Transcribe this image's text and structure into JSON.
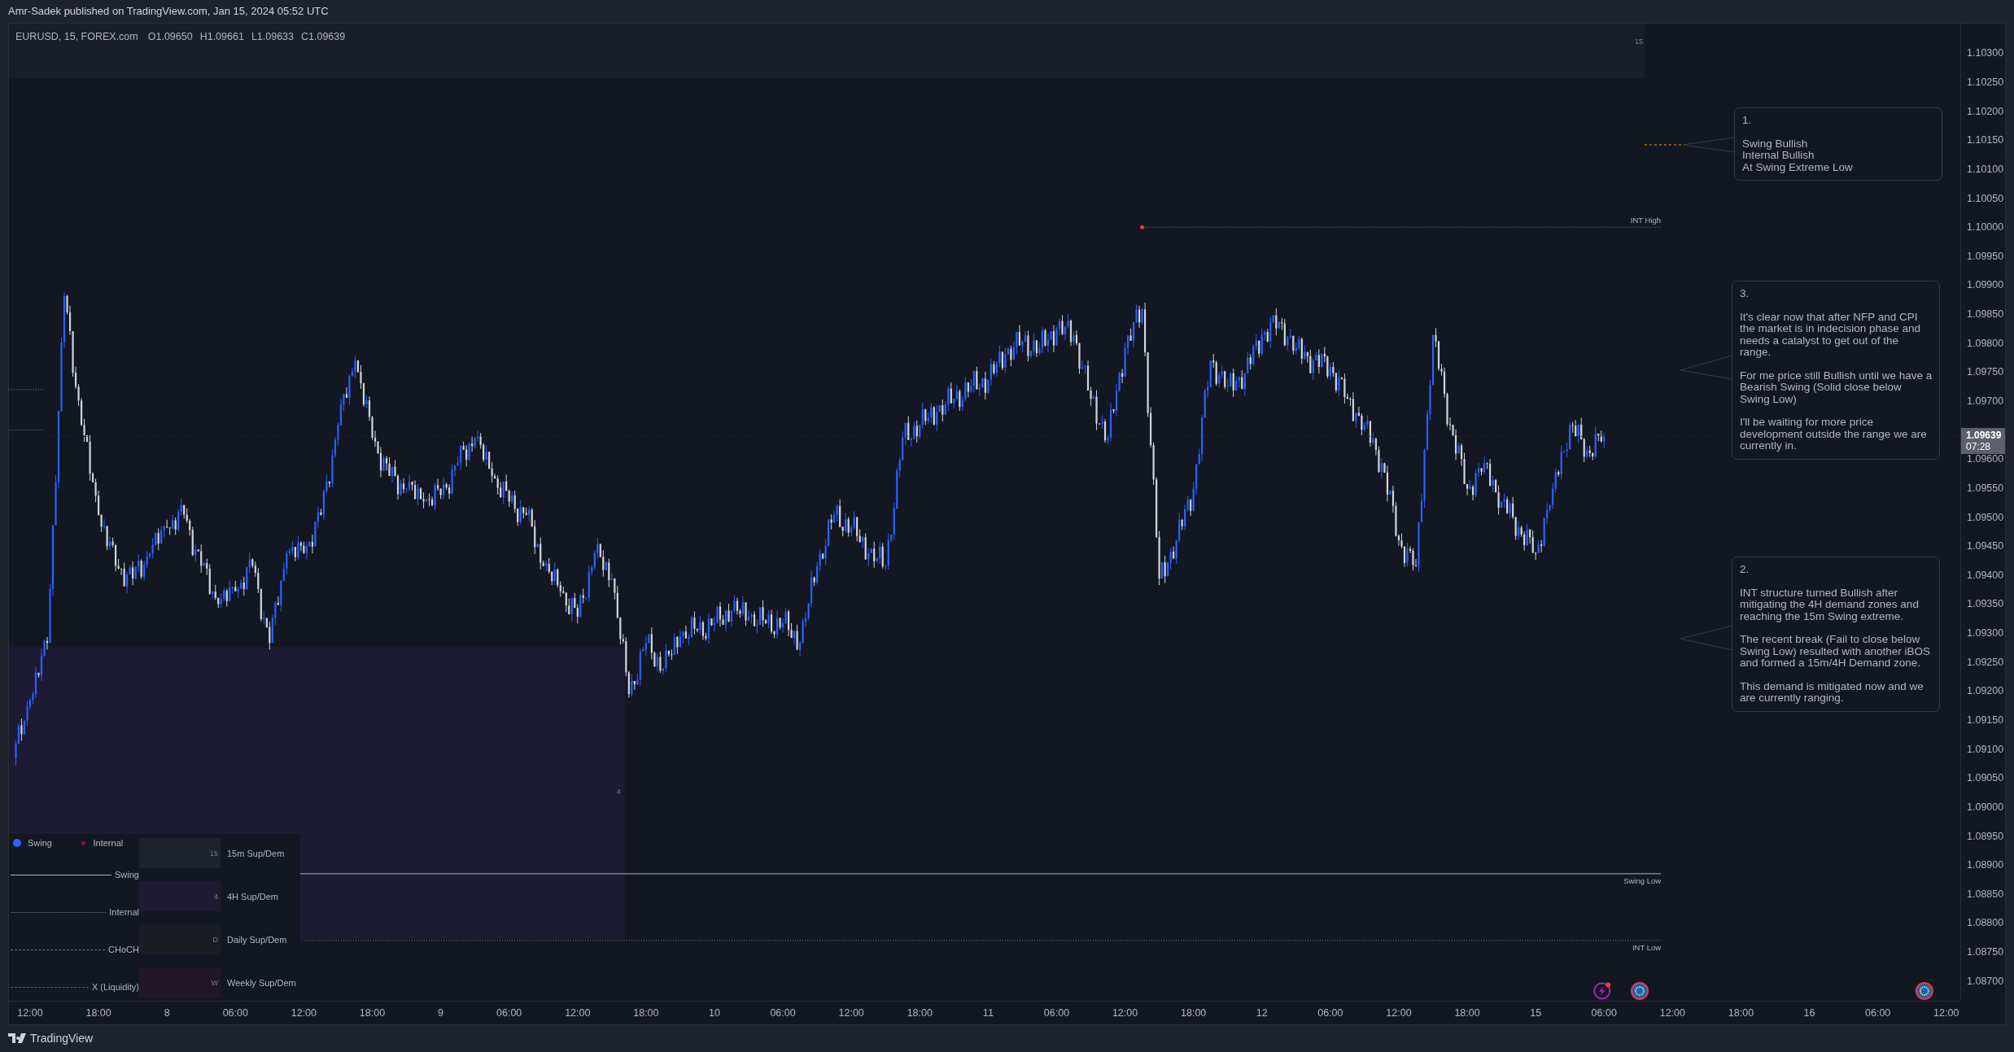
{
  "top_bar": {
    "text": "Amr-Sadek published on TradingView.com, Jan 15, 2024 05:52 UTC"
  },
  "header": {
    "symbol": "EURUSD, 15, FOREX.com",
    "ohlc": [
      "O1.09650",
      "H1.09661",
      "L1.09633",
      "C1.09639"
    ],
    "tag": "15"
  },
  "chart": {
    "levels": [
      {
        "label": "INT High"
      },
      {
        "label": "Swing Low"
      },
      {
        "label": "INT Low"
      }
    ],
    "zone": {
      "label": "4"
    },
    "events": [
      {
        "kind": "lightning"
      },
      {
        "kind": "flag"
      },
      {
        "kind": "flag"
      }
    ]
  },
  "price_axis": {
    "labels": [
      "1.10300",
      "1.10250",
      "1.10200",
      "1.10150",
      "1.10100",
      "1.10050",
      "1.10000",
      "1.09950",
      "1.09900",
      "1.09850",
      "1.09800",
      "1.09750",
      "1.09700",
      "1.09600",
      "1.09550",
      "1.09500",
      "1.09450",
      "1.09400",
      "1.09350",
      "1.09300",
      "1.09250",
      "1.09200",
      "1.09150",
      "1.09100",
      "1.09050",
      "1.09000",
      "1.08950",
      "1.08900",
      "1.08850",
      "1.08800",
      "1.08750",
      "1.08700"
    ],
    "last_price": "1.09639",
    "countdown": "07:28"
  },
  "time_axis": {
    "labels": [
      "12:00",
      "18:00",
      "8",
      "06:00",
      "12:00",
      "18:00",
      "9",
      "06:00",
      "12:00",
      "18:00",
      "10",
      "06:00",
      "12:00",
      "18:00",
      "11",
      "06:00",
      "12:00",
      "18:00",
      "12",
      "06:00",
      "12:00",
      "18:00",
      "15",
      "06:00",
      "12:00",
      "18:00",
      "16",
      "06:00",
      "12:00"
    ]
  },
  "notes": [
    {
      "number": "1.",
      "paragraphs": [
        "Swing Bullish\nInternal Bullish\nAt Swing Extreme Low"
      ]
    },
    {
      "number": "3.",
      "paragraphs": [
        "It's clear now that after NFP and CPI the market is in indecision phase and needs a catalyst to get out of the range.",
        "For me price still Bullish until we have a Bearish Swing (Solid close below Swing Low)",
        "I'll be waiting for more price development outside the range we are currently in."
      ]
    },
    {
      "number": "2.",
      "paragraphs": [
        "INT structure turned Bullish after mitigating the 4H demand zones and reaching the 15m Swing extreme.",
        "The recent break (Fail to close below Swing Low) resulted with another iBOS and formed a 15m/4H Demand zone.",
        "This demand is mitigated now and we are currently ranging."
      ]
    }
  ],
  "legend": {
    "markers": [
      {
        "label": "Swing",
        "kind": "large",
        "color": "#2962ff"
      },
      {
        "label": "Internal",
        "kind": "small",
        "color": "#880e4f"
      }
    ],
    "lines": [
      {
        "label": "Swing"
      },
      {
        "label": "Internal"
      },
      {
        "label": "CHoCH"
      },
      {
        "label": "X (Liquidity)"
      }
    ],
    "zones": [
      {
        "label": "15m Sup/Dem",
        "tag": "15",
        "color": "#1e222d"
      },
      {
        "label": "4H Sup/Dem",
        "tag": "4",
        "color": "#1e1b33"
      },
      {
        "label": "Daily Sup/Dem",
        "tag": "D",
        "color": "#1a1e22"
      },
      {
        "label": "Weekly Sup/Dem",
        "tag": "W",
        "color": "#22172a"
      }
    ]
  },
  "footer": {
    "brand": "TradingView"
  }
}
